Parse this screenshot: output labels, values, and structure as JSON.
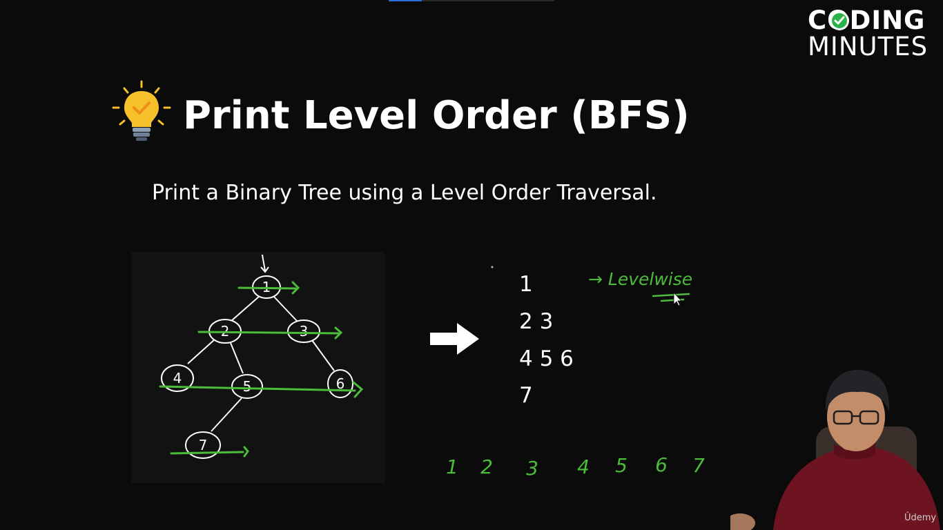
{
  "logo": {
    "line1": "CODING",
    "line2": "MINUTES"
  },
  "slide": {
    "title": "Print Level Order (BFS)",
    "subtitle": "Print a Binary Tree using a Level Order Traversal."
  },
  "tree": {
    "nodes": [
      "1",
      "2",
      "3",
      "4",
      "5",
      "6",
      "7"
    ]
  },
  "output": {
    "lines": [
      "1",
      "2 3",
      "4 5 6",
      "7"
    ]
  },
  "annotations": {
    "levelwise": "→ Levelwise",
    "sequence": [
      "1",
      "2",
      "3",
      "4",
      "5",
      "6",
      "7"
    ]
  },
  "watermark": "Ûdemy",
  "colors": {
    "background": "#0b0b0b",
    "ink_green": "#4cbd3a",
    "bulb": "#f6c12b"
  }
}
